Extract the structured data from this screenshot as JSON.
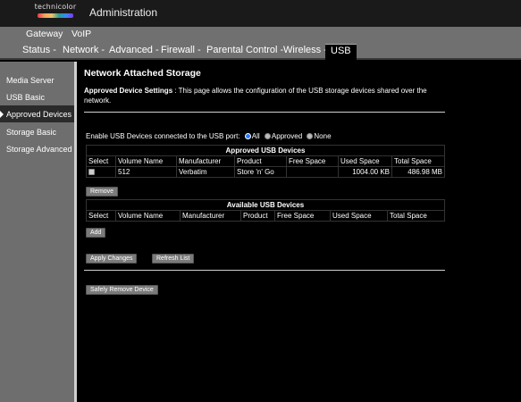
{
  "brand": {
    "logo_text": "technicolor"
  },
  "header": {
    "title": "Administration"
  },
  "nav_primary": [
    {
      "label": "Gateway"
    },
    {
      "label": "VoIP"
    }
  ],
  "nav_secondary": [
    {
      "label": "Status -"
    },
    {
      "label": "Network -"
    },
    {
      "label": "Advanced -"
    },
    {
      "label": "Firewall -"
    },
    {
      "label": "Parental Control -"
    },
    {
      "label": "Wireless -"
    },
    {
      "label": "USB",
      "active": true
    }
  ],
  "sidebar": {
    "items": [
      {
        "label": "Media Server"
      },
      {
        "label": "USB Basic"
      },
      {
        "label": "Approved Devices",
        "active": true
      },
      {
        "label": "Storage Basic"
      },
      {
        "label": "Storage Advanced"
      }
    ]
  },
  "main": {
    "title": "Network Attached Storage",
    "desc_label": "Approved Device Settings",
    "desc_text": " :  This page allows the configuration of the USB storage devices shared over the network.",
    "enable_label": "Enable USB Devices connected to the USB port:",
    "enable_options": [
      {
        "label": "All",
        "checked": true
      },
      {
        "label": "Approved",
        "checked": false
      },
      {
        "label": "None",
        "checked": false
      }
    ],
    "approved_table": {
      "caption": "Approved USB Devices",
      "headers": [
        "Select",
        "Volume Name",
        "Manufacturer",
        "Product",
        "Free Space",
        "Used Space",
        "Total Space"
      ],
      "rows": [
        {
          "select": false,
          "volume": "512",
          "manufacturer": "Verbatim",
          "product": "Store 'n' Go",
          "free": "",
          "used": "1004.00 KB",
          "total": "486.98 MB"
        }
      ]
    },
    "remove_label": "Remove",
    "available_table": {
      "caption": "Available USB Devices",
      "headers": [
        "Select",
        "Volume Name",
        "Manufacturer",
        "Product",
        "Free Space",
        "Used Space",
        "Total Space"
      ]
    },
    "add_label": "Add",
    "apply_label": "Apply Changes",
    "refresh_label": "Refresh List",
    "safely_remove_label": "Safely Remove Device"
  }
}
